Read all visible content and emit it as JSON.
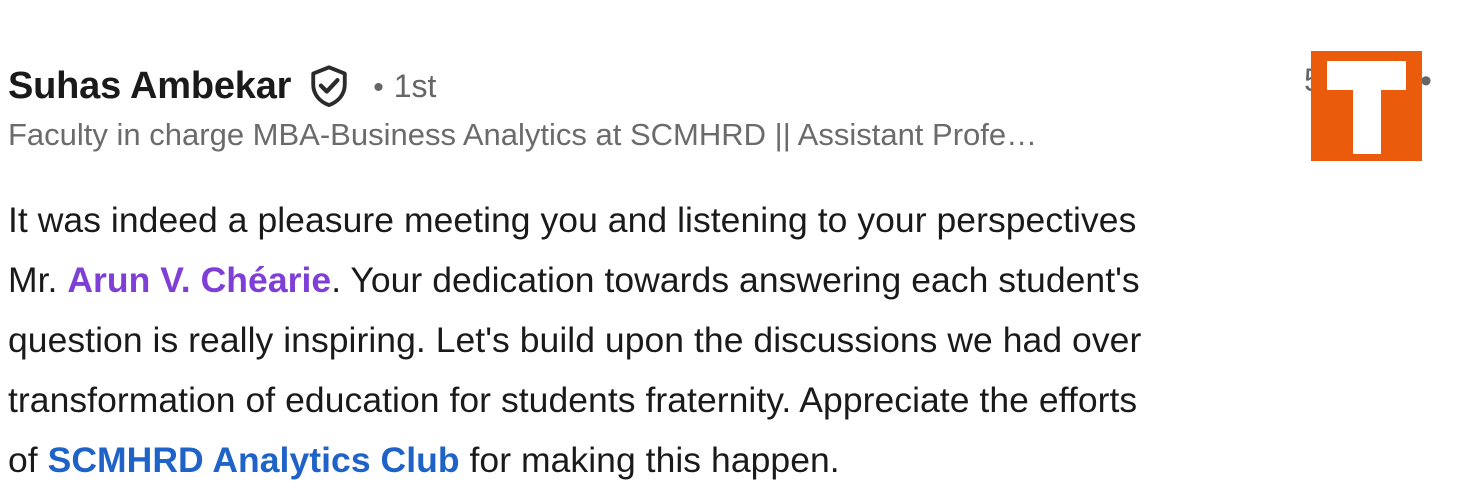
{
  "comment": {
    "author": {
      "name": "Suhas Ambekar",
      "verified_icon": "shield-check-icon",
      "degree_separator": "•",
      "degree": "1st",
      "headline": "Faculty in charge MBA-Business Analytics at SCMHRD || Assistant Profe…"
    },
    "timestamp": "5",
    "more_menu": "•",
    "org_logo_icon": "letter-t-logo",
    "body": {
      "line1": "It was indeed a pleasure meeting you and listening to your perspectives",
      "line2_prefix": "Mr. ",
      "mention_person": "Arun V. Chéarie",
      "line2_suffix": ". Your dedication towards answering each student's",
      "line3": "question is really inspiring. Let's build upon the discussions we had over",
      "line4": "transformation of education for students fraternity. Appreciate the efforts",
      "line5_prefix": "of ",
      "mention_org": "SCMHRD Analytics Club",
      "line5_suffix": " for making this happen."
    }
  },
  "colors": {
    "person_mention": "#7f3fd6",
    "org_mention": "#1f63c8",
    "logo_background": "#ea5b0c",
    "secondary_text": "#6b6b6b"
  }
}
